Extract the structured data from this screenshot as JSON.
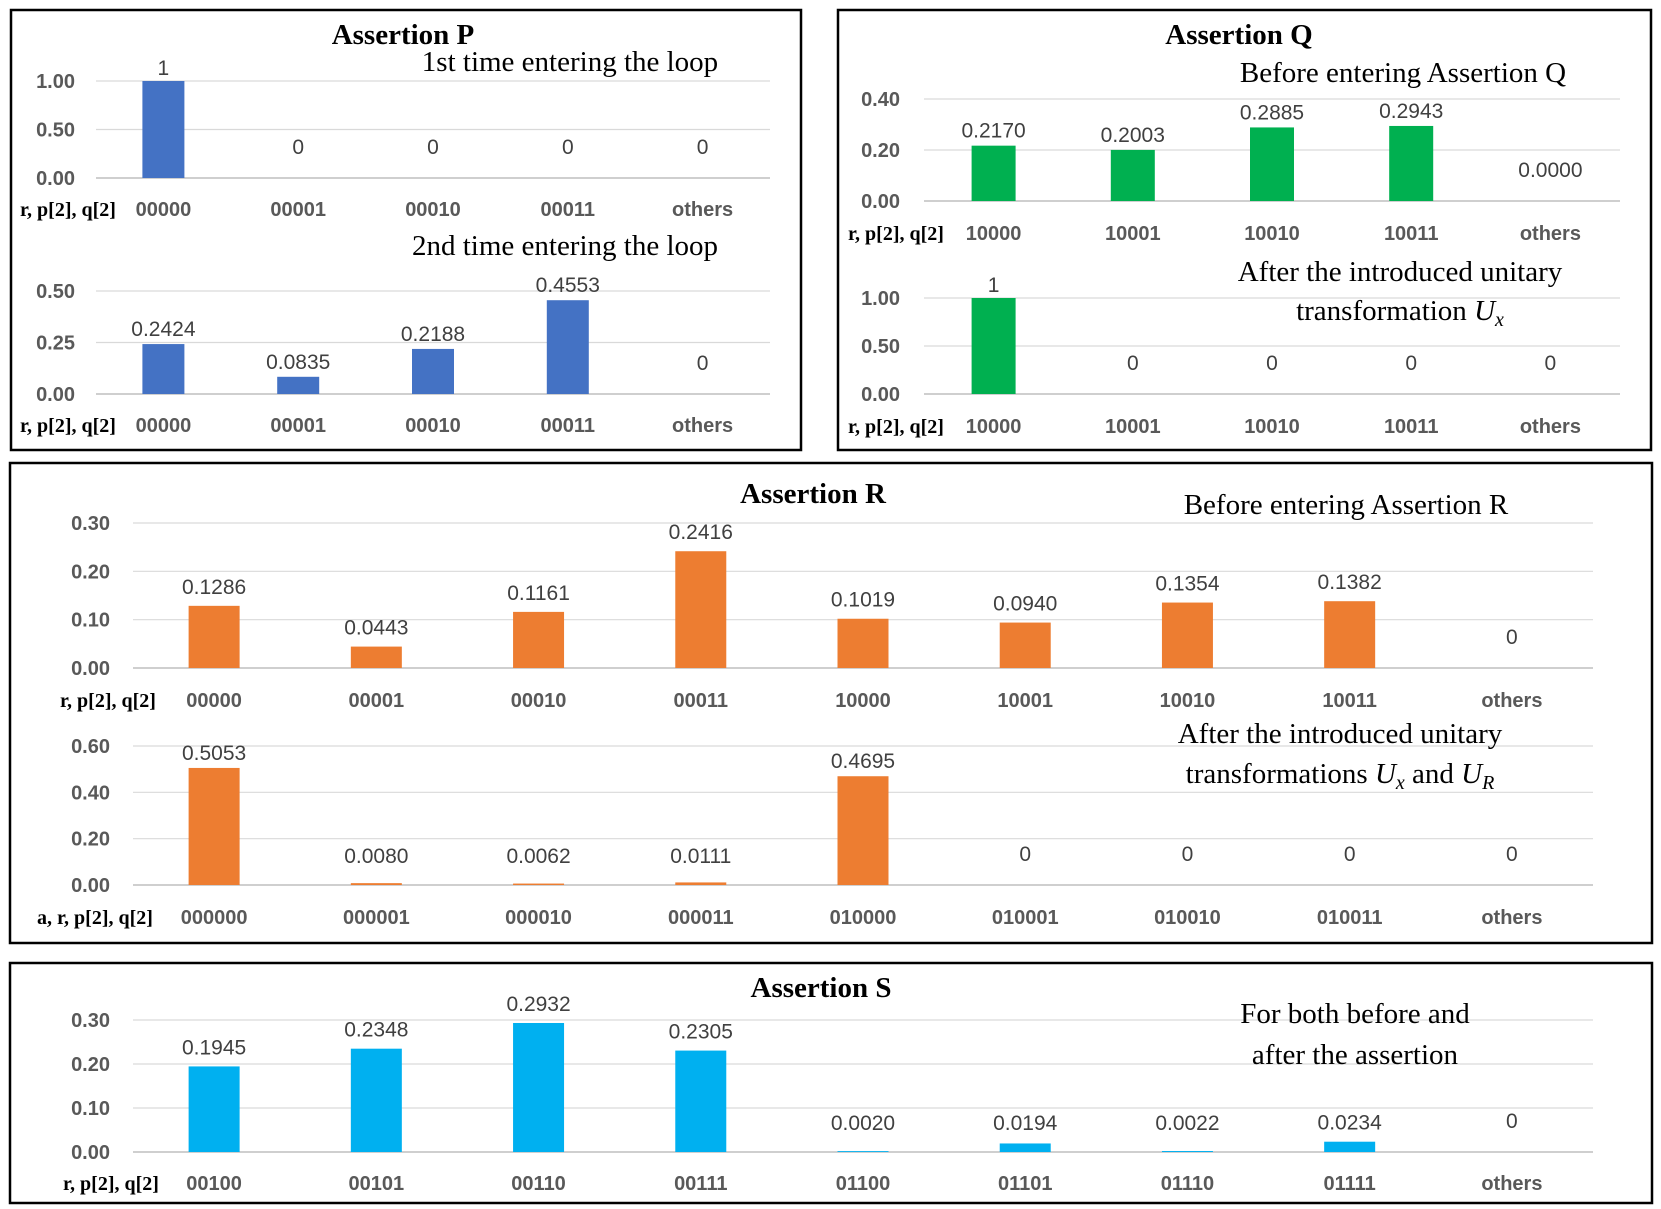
{
  "chart_data": [
    {
      "type": "bar",
      "panel": "Assertion P",
      "title": "Assertion P",
      "subtitle": "1st time entering the loop",
      "xlabel": "r, p[2], q[2]",
      "categories": [
        "00000",
        "00001",
        "00010",
        "00011",
        "others"
      ],
      "values": [
        1,
        0,
        0,
        0,
        0
      ],
      "data_labels": [
        "1",
        "0",
        "0",
        "0",
        "0"
      ],
      "ylim": [
        0,
        1
      ],
      "yticks": [
        0,
        0.5,
        1
      ],
      "ytick_labels": [
        "0.00",
        "0.50",
        "1.00"
      ],
      "color": "#4472C4",
      "grid": true,
      "legend": "none"
    },
    {
      "type": "bar",
      "panel": "Assertion P",
      "subtitle": "2nd time entering the loop",
      "xlabel": "r, p[2], q[2]",
      "categories": [
        "00000",
        "00001",
        "00010",
        "00011",
        "others"
      ],
      "values": [
        0.2424,
        0.0835,
        0.2188,
        0.4553,
        0
      ],
      "data_labels": [
        "0.2424",
        "0.0835",
        "0.2188",
        "0.4553",
        "0"
      ],
      "ylim": [
        0,
        0.5
      ],
      "yticks": [
        0,
        0.25,
        0.5
      ],
      "ytick_labels": [
        "0.00",
        "0.25",
        "0.50"
      ],
      "color": "#4472C4",
      "grid": true,
      "legend": "none"
    },
    {
      "type": "bar",
      "panel": "Assertion Q",
      "title": "Assertion Q",
      "subtitle": "Before entering Assertion Q",
      "xlabel": "r, p[2], q[2]",
      "categories": [
        "10000",
        "10001",
        "10010",
        "10011",
        "others"
      ],
      "values": [
        0.217,
        0.2003,
        0.2885,
        0.2943,
        0
      ],
      "data_labels": [
        "0.2170",
        "0.2003",
        "0.2885",
        "0.2943",
        "0.0000"
      ],
      "ylim": [
        0,
        0.4
      ],
      "yticks": [
        0,
        0.2,
        0.4
      ],
      "ytick_labels": [
        "0.00",
        "0.20",
        "0.40"
      ],
      "color": "#00B050",
      "grid": true,
      "legend": "none"
    },
    {
      "type": "bar",
      "panel": "Assertion Q",
      "subtitle_lines": [
        "After the introduced unitary",
        "transformation U",
        "x"
      ],
      "xlabel": "r, p[2], q[2]",
      "categories": [
        "10000",
        "10001",
        "10010",
        "10011",
        "others"
      ],
      "values": [
        1,
        0,
        0,
        0,
        0
      ],
      "data_labels": [
        "1",
        "0",
        "0",
        "0",
        "0"
      ],
      "ylim": [
        0,
        1
      ],
      "yticks": [
        0,
        0.5,
        1
      ],
      "ytick_labels": [
        "0.00",
        "0.50",
        "1.00"
      ],
      "color": "#00B050",
      "grid": true,
      "legend": "none"
    },
    {
      "type": "bar",
      "panel": "Assertion R",
      "title": "Assertion R",
      "subtitle": "Before entering Assertion R",
      "xlabel": "r, p[2], q[2]",
      "categories": [
        "00000",
        "00001",
        "00010",
        "00011",
        "10000",
        "10001",
        "10010",
        "10011",
        "others"
      ],
      "values": [
        0.1286,
        0.0443,
        0.1161,
        0.2416,
        0.1019,
        0.094,
        0.1354,
        0.1382,
        0
      ],
      "data_labels": [
        "0.1286",
        "0.0443",
        "0.1161",
        "0.2416",
        "0.1019",
        "0.0940",
        "0.1354",
        "0.1382",
        "0"
      ],
      "ylim": [
        0,
        0.3
      ],
      "yticks": [
        0,
        0.1,
        0.2,
        0.3
      ],
      "ytick_labels": [
        "0.00",
        "0.10",
        "0.20",
        "0.30"
      ],
      "color": "#ED7D31",
      "grid": true,
      "legend": "none"
    },
    {
      "type": "bar",
      "panel": "Assertion R",
      "subtitle_lines": [
        "After the introduced unitary",
        "transformations U",
        "x",
        " and U",
        "R"
      ],
      "xlabel": "a, r, p[2], q[2]",
      "categories": [
        "000000",
        "000001",
        "000010",
        "000011",
        "010000",
        "010001",
        "010010",
        "010011",
        "others"
      ],
      "values": [
        0.5053,
        0.008,
        0.0062,
        0.0111,
        0.4695,
        0,
        0,
        0,
        0
      ],
      "data_labels": [
        "0.5053",
        "0.0080",
        "0.0062",
        "0.0111",
        "0.4695",
        "0",
        "0",
        "0",
        "0"
      ],
      "ylim": [
        0,
        0.6
      ],
      "yticks": [
        0,
        0.2,
        0.4,
        0.6
      ],
      "ytick_labels": [
        "0.00",
        "0.20",
        "0.40",
        "0.60"
      ],
      "color": "#ED7D31",
      "grid": true,
      "legend": "none"
    },
    {
      "type": "bar",
      "panel": "Assertion S",
      "title": "Assertion S",
      "subtitle_lines": [
        "For both before and",
        "after the assertion"
      ],
      "xlabel": "r, p[2], q[2]",
      "categories": [
        "00100",
        "00101",
        "00110",
        "00111",
        "01100",
        "01101",
        "01110",
        "01111",
        "others"
      ],
      "values": [
        0.1945,
        0.2348,
        0.2932,
        0.2305,
        0.002,
        0.0194,
        0.0022,
        0.0234,
        0
      ],
      "data_labels": [
        "0.1945",
        "0.2348",
        "0.2932",
        "0.2305",
        "0.0020",
        "0.0194",
        "0.0022",
        "0.0234",
        "0"
      ],
      "ylim": [
        0,
        0.3
      ],
      "yticks": [
        0,
        0.1,
        0.2,
        0.3
      ],
      "ytick_labels": [
        "0.00",
        "0.10",
        "0.20",
        "0.30"
      ],
      "color": "#00B0F0",
      "grid": true,
      "legend": "none"
    }
  ]
}
